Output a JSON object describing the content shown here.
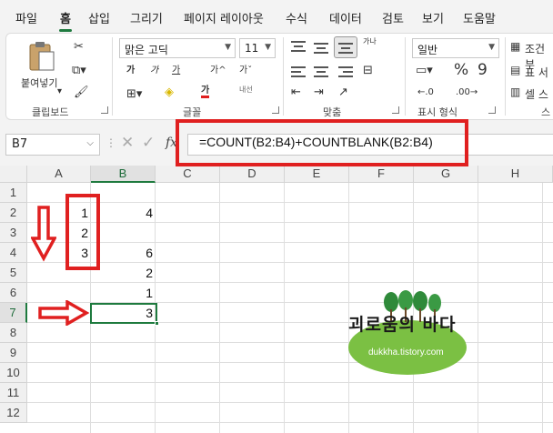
{
  "menu": {
    "tabs": [
      "파일",
      "홈",
      "삽입",
      "그리기",
      "페이지 레이아웃",
      "수식",
      "데이터",
      "검토",
      "보기",
      "도움말"
    ],
    "active": "홈"
  },
  "ribbon": {
    "clipboard": {
      "paste_label": "붙여넣기",
      "group_label": "클립보드"
    },
    "font": {
      "font_name": "맑은 고딕",
      "font_size": "11",
      "group_label": "글꼴",
      "bold_glyph": "가",
      "italic_glyph": "가",
      "underline_glyph": "가",
      "grow_glyph": "가^",
      "shrink_glyph": "가ˇ",
      "color_glyph": "가",
      "phonetic_label": "내선"
    },
    "alignment": {
      "group_label": "맞춤",
      "wrap_label": "가나"
    },
    "number": {
      "format": "일반",
      "group_label": "표시 형식"
    },
    "styles": {
      "conditional_label": "조건부",
      "table_label": "표 서",
      "cell_label": "셀 스",
      "group_label": "스"
    }
  },
  "formula_bar": {
    "name_box": "B7",
    "fx_label": "fx",
    "formula": "=COUNT(B2:B4)+COUNTBLANK(B2:B4)"
  },
  "sheet": {
    "columns": [
      "A",
      "B",
      "C",
      "D",
      "E",
      "F",
      "G",
      "H"
    ],
    "selected_column": "B",
    "rows": [
      "1",
      "2",
      "3",
      "4",
      "5",
      "6",
      "7",
      "8",
      "9",
      "10",
      "11",
      "12"
    ],
    "selected_row": "7",
    "cells": {
      "A2": "1",
      "A3": "2",
      "A4": "3",
      "B2": "4",
      "B4": "6",
      "B5": "2",
      "B6": "1",
      "B7": "3"
    }
  },
  "watermark": {
    "title": "괴로움의 바다",
    "url": "dukkha.tistory.com"
  },
  "colors": {
    "accent": "#1e7a3e",
    "annotation": "#e02020",
    "watermark_green": "#7bc043"
  }
}
